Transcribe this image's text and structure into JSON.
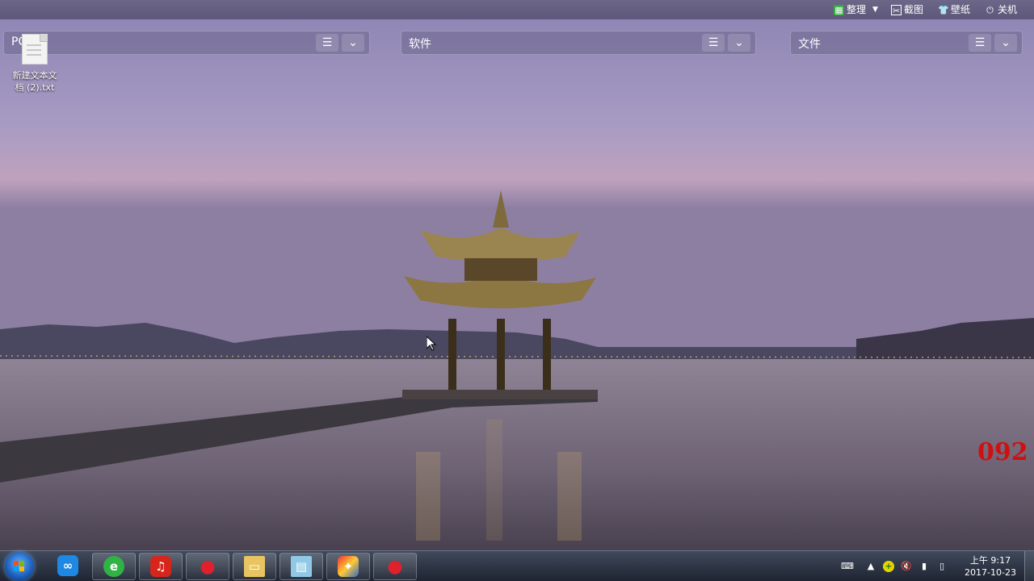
{
  "toolbar": {
    "organize_label": "整理",
    "screenshot_label": "截图",
    "wallpaper_label": "壁纸",
    "shutdown_label": "关机"
  },
  "fences": [
    {
      "title": "PC"
    },
    {
      "title": "软件"
    },
    {
      "title": "文件"
    }
  ],
  "desktop_icons": [
    {
      "label_line1": "新建文本文",
      "label_line2": "档 (2).txt"
    }
  ],
  "watermark": "092",
  "taskbar": {
    "apps": [
      "baidu-netdisk",
      "360-browser",
      "netease-music",
      "app-red",
      "file-explorer",
      "notepad",
      "media-app",
      "app-red-2"
    ]
  },
  "clock": {
    "time": "上午 9:17",
    "date": "2017-10-23"
  }
}
